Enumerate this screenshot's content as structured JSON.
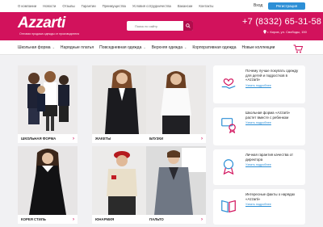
{
  "topbar": {
    "links": [
      "О компании",
      "Новости",
      "Отзывы",
      "Гарантии",
      "Преимущества",
      "Условия сотрудничества",
      "Вакансии",
      "Контакты"
    ],
    "login": "Вход",
    "register": "Регистрация"
  },
  "header": {
    "logo": "Azzarti",
    "logo_sub": "Оптовая продажа одежды от производителя",
    "search_placeholder": "Поиск по сайту",
    "phone": "+7 (8332) 65-31-58",
    "address": "г. Киров, ул. Свободы, 150"
  },
  "nav": {
    "items": [
      {
        "label": "Школьная форма",
        "dropdown": true
      },
      {
        "label": "Нарядные платья",
        "dropdown": false
      },
      {
        "label": "Повседневная одежда",
        "dropdown": true
      },
      {
        "label": "Верхняя одежда",
        "dropdown": true
      },
      {
        "label": "Корпоративная одежда",
        "dropdown": false
      },
      {
        "label": "Новые коллекции",
        "dropdown": false
      }
    ]
  },
  "categories": [
    {
      "label": "ШКОЛЬНАЯ ФОРМА"
    },
    {
      "label": "ЖАКЕТЫ"
    },
    {
      "label": "БЛУЗКИ"
    },
    {
      "label": "КОРЕЯ СТИЛЬ"
    },
    {
      "label": "ЮНАРМИЯ"
    },
    {
      "label": "ПАЛЬТО"
    }
  ],
  "aside": [
    {
      "text": "Почему лучше покупать одежду для детей и подростков в «Azzarti»",
      "more": "Узнать подробнее",
      "icon": "heart-hand-icon"
    },
    {
      "text": "Школьная форма «Azzarti» растет вместе с ребенком",
      "more": "Узнать подробнее",
      "icon": "growth-ribbon-icon"
    },
    {
      "text": "Личная гарантия качества от директора",
      "more": "Узнать подробнее",
      "icon": "medal-icon"
    },
    {
      "text": "Интересные факты о нарядах «Azzarti»",
      "more": "Узнать подробнее",
      "icon": "book-icon"
    }
  ],
  "colors": {
    "brand": "#d2125c",
    "accent_blue": "#2c8fd6",
    "background": "#f1f1f3"
  }
}
